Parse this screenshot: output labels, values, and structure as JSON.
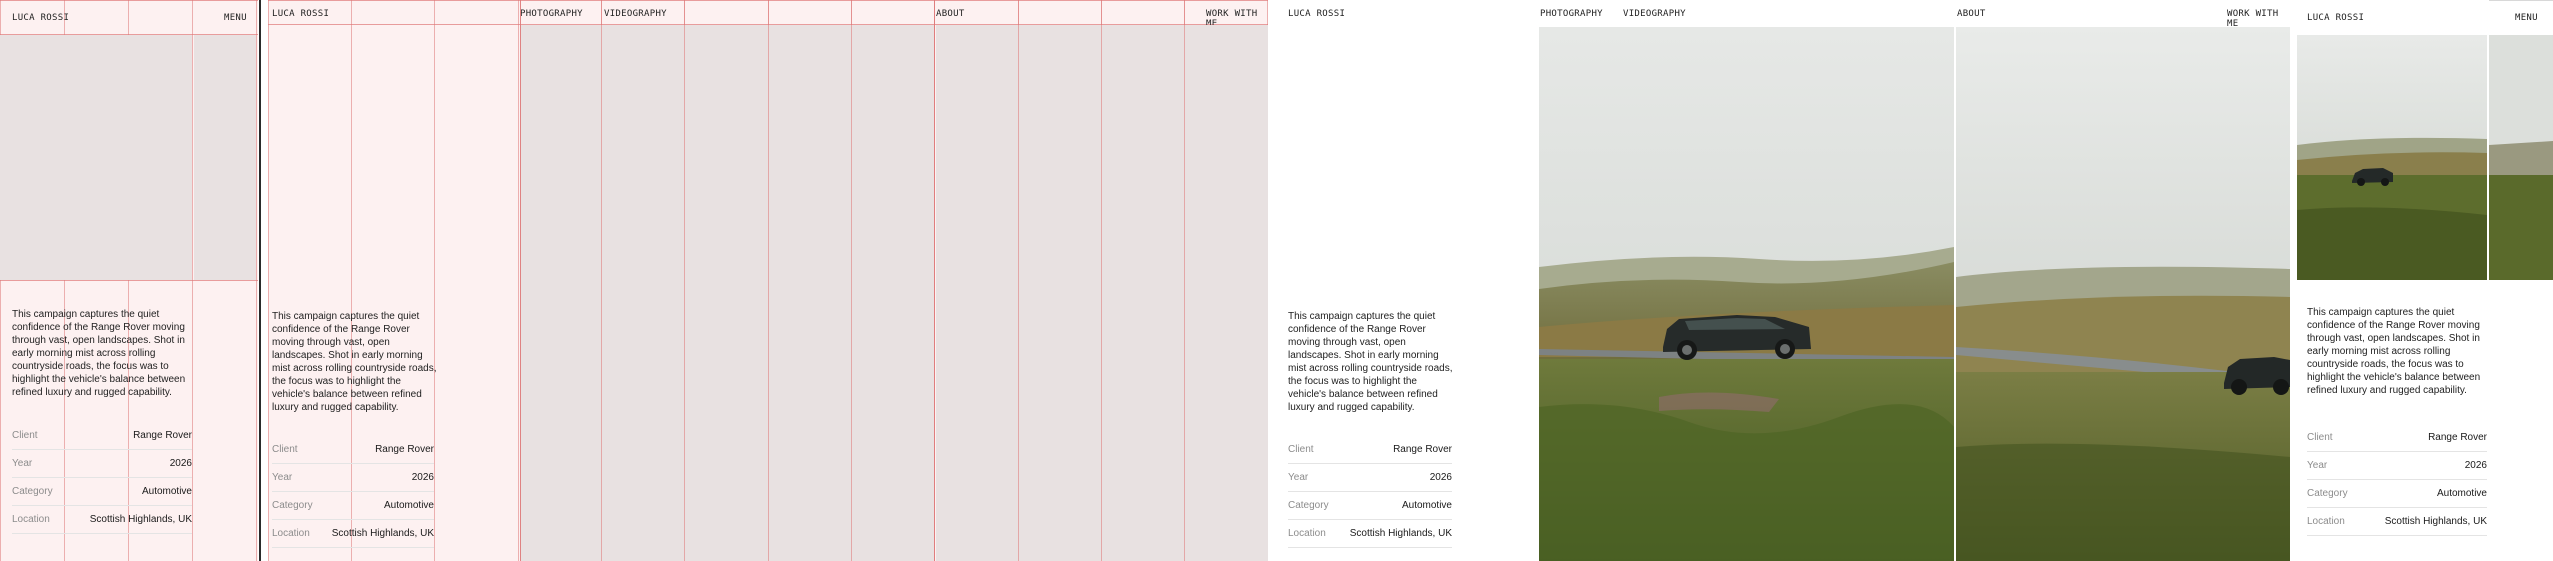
{
  "brand": "LUCA ROSSI",
  "nav": {
    "menu": "MENU",
    "photography": "PHOTOGRAPHY",
    "videography": "VIDEOGRAPHY",
    "about": "ABOUT",
    "work_with_me": "WORK WITH ME"
  },
  "project": {
    "description": "This campaign captures the quiet confidence of the Range Rover moving through vast, open landscapes. Shot in early morning mist across rolling countryside roads, the focus was to highlight the vehicle's balance between refined luxury and rugged capability.",
    "meta": [
      {
        "label": "Client",
        "value": "Range Rover"
      },
      {
        "label": "Year",
        "value": "2026"
      },
      {
        "label": "Category",
        "value": "Automotive"
      },
      {
        "label": "Location",
        "value": "Scottish Highlands, UK"
      }
    ]
  },
  "colors": {
    "grid_line": "#de7878",
    "grid_fill": "#fdf1f1",
    "placeholder": "#e8e1e1"
  }
}
